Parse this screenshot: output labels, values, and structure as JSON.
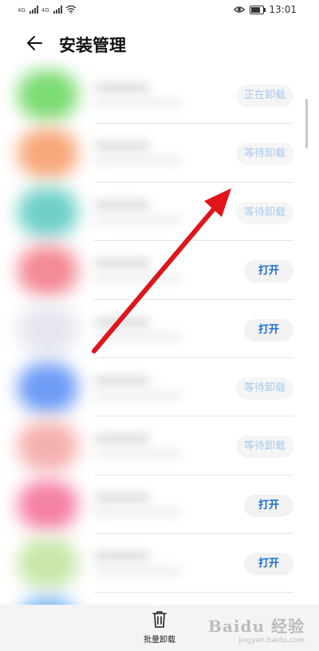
{
  "status_bar": {
    "left_tags": [
      "4G",
      "4G"
    ],
    "time": "13:01"
  },
  "header": {
    "title": "安装管理"
  },
  "apps": [
    {
      "icon_color": "#7bdc72",
      "action": "正在卸载",
      "state": "disabled"
    },
    {
      "icon_color": "#f7a77a",
      "action": "等待卸载",
      "state": "disabled"
    },
    {
      "icon_color": "#6fd0c9",
      "action": "等待卸载",
      "state": "disabled"
    },
    {
      "icon_color": "#f48a95",
      "action": "打开",
      "state": "active"
    },
    {
      "icon_color": "#e6e6ef",
      "action": "打开",
      "state": "active"
    },
    {
      "icon_color": "#6e9bf5",
      "action": "等待卸载",
      "state": "disabled"
    },
    {
      "icon_color": "#f5b0ae",
      "action": "等待卸载",
      "state": "disabled"
    },
    {
      "icon_color": "#f581a5",
      "action": "打开",
      "state": "active"
    },
    {
      "icon_color": "#c7e7a9",
      "action": "打开",
      "state": "active"
    },
    {
      "icon_color": "#77b3f7",
      "action": "",
      "state": "none"
    }
  ],
  "bottom_bar": {
    "batch_uninstall_label": "批量卸载"
  },
  "watermark": {
    "brand": "Baidu 经验",
    "url": "jingyan.baidu.com"
  },
  "colors": {
    "accent": "#1a6dd0",
    "disabled_text": "#a9c9ee",
    "arrow": "#e0141b"
  }
}
